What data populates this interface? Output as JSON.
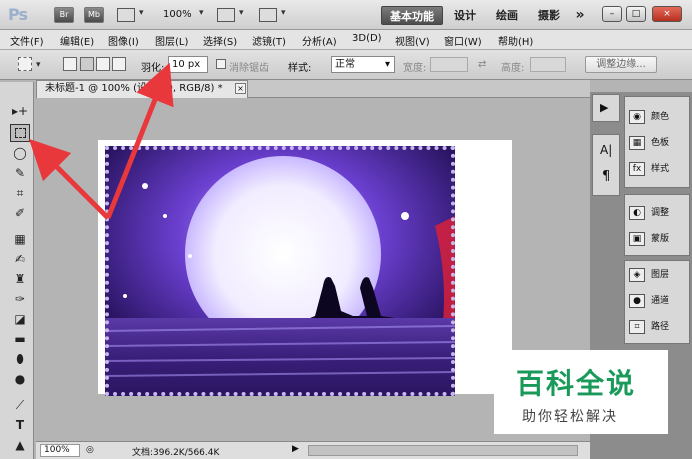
{
  "titlebar": {
    "logo": "Ps",
    "bridge_label": "Br",
    "minibridge_label": "Mb",
    "zoom": "100%",
    "workspaces": [
      "基本功能",
      "设计",
      "绘画",
      "摄影"
    ],
    "more": "»"
  },
  "window_controls": {
    "minimize": "–",
    "restore": "□",
    "close": "×"
  },
  "menu": [
    "文件(F)",
    "编辑(E)",
    "图像(I)",
    "图层(L)",
    "选择(S)",
    "滤镜(T)",
    "分析(A)",
    "3D(D)",
    "视图(V)",
    "窗口(W)",
    "帮助(H)"
  ],
  "options": {
    "feather_label": "羽化:",
    "feather_value": "10 px",
    "antialias_label": "消除锯齿",
    "style_label": "样式:",
    "style_value": "正常",
    "width_label": "宽度:",
    "height_label": "高度:",
    "refine_label": "调整边缘..."
  },
  "document": {
    "tab_title": "未标题-1 @ 100% (设置 10, RGB/8) *",
    "tab_close": "×"
  },
  "status": {
    "zoom": "100%",
    "doc_info": "文档:396.2K/566.4K"
  },
  "panels": {
    "narrow_icons": [
      "▶",
      "A|",
      "¶"
    ],
    "group1": [
      "颜色",
      "色板",
      "样式"
    ],
    "group2": [
      "调整",
      "蒙版"
    ],
    "group3": [
      "图层",
      "通道",
      "路径"
    ]
  },
  "watermark": {
    "title": "百科全说",
    "subtitle": "助你轻松解决"
  },
  "colors": {
    "annotation_arrow": "#e8383b",
    "watermark_green": "#1a9a5a",
    "scene_purple": "#4b2a8f"
  }
}
